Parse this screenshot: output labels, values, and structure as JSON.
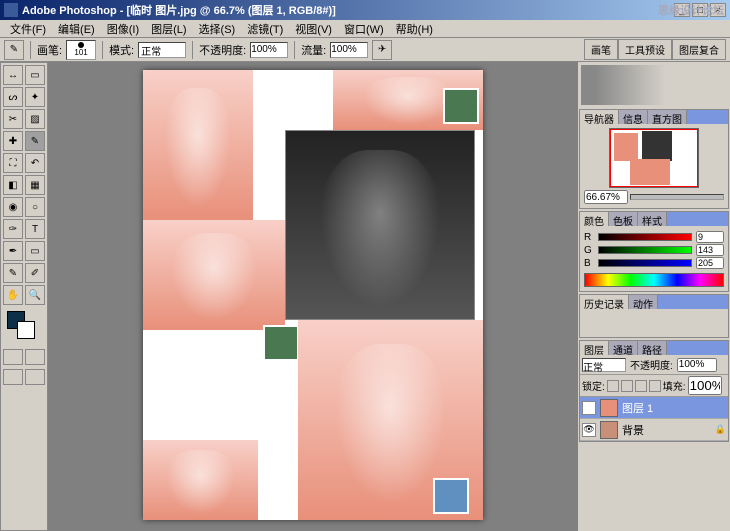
{
  "title": "Adobe Photoshop - [临时 图片.jpg @ 66.7% (图层 1, RGB/8#)]",
  "menu": {
    "file": "文件(F)",
    "edit": "编辑(E)",
    "image": "图像(I)",
    "layer": "图层(L)",
    "select": "选择(S)",
    "filter": "滤镜(T)",
    "view": "视图(V)",
    "window": "窗口(W)",
    "help": "帮助(H)"
  },
  "options": {
    "brush_label": "画笔:",
    "brush_size": "101",
    "mode_label": "模式:",
    "mode_value": "正常",
    "opacity_label": "不透明度:",
    "opacity_value": "100%",
    "flow_label": "流量:",
    "flow_value": "100%"
  },
  "doc_tabs": {
    "brushes": "画笔",
    "tool_presets": "工具预设",
    "layer_comps": "图层复合"
  },
  "navigator": {
    "tab1": "导航器",
    "tab2": "信息",
    "tab3": "直方图",
    "zoom": "66.67%"
  },
  "color": {
    "tab1": "颜色",
    "tab2": "色板",
    "tab3": "样式",
    "r_label": "R",
    "r_value": "9",
    "g_label": "G",
    "g_value": "143",
    "b_label": "B",
    "b_value": "205"
  },
  "history": {
    "tab1": "历史记录",
    "tab2": "动作"
  },
  "layers": {
    "tab1": "图层",
    "tab2": "通道",
    "tab3": "路径",
    "blend_mode": "正常",
    "opacity_label": "不透明度:",
    "opacity_value": "100%",
    "lock_label": "锁定:",
    "fill_label": "填充:",
    "fill_value": "100%",
    "layer1_name": "图层 1",
    "bg_name": "背景"
  },
  "watermark": "思缘设计论坛"
}
